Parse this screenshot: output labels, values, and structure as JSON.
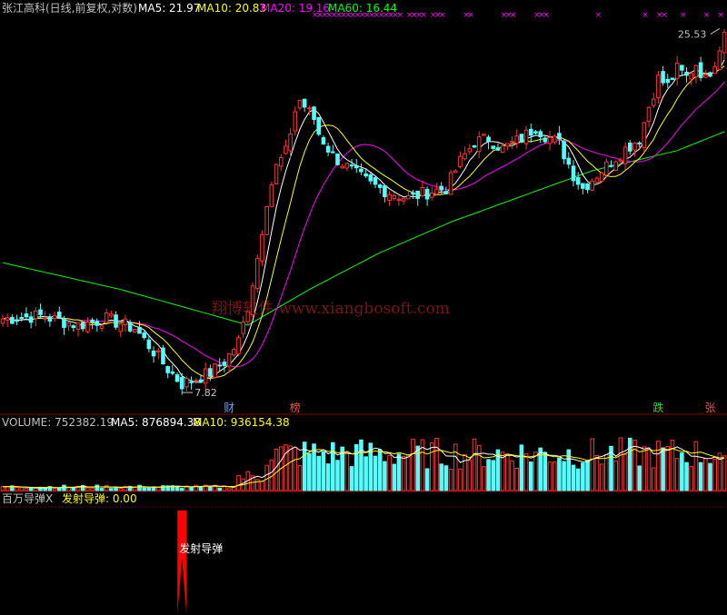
{
  "main_header": {
    "title": "张江高科(日线,前复权,对数)",
    "ma5": "MA5: 21.97",
    "ma10": "MA10: 20.83",
    "ma20": "MA20: 19.16",
    "ma60": "MA60: 16.44"
  },
  "volume_header": {
    "label": "VOLUME: 752382.19",
    "ma5": "MA5: 876894.38",
    "ma10": "MA10: 936154.38"
  },
  "indicator_header": {
    "name": "百万导弹X",
    "value": "发射导弹: 0.00"
  },
  "annotations": {
    "high": "25.53",
    "low": "7.82",
    "watermark": "翔博软件 www.xiangbosoft.com",
    "missile": "发射导弹"
  },
  "event_tags": [
    {
      "label": "财",
      "index": 48,
      "color": "#5fa8ff"
    },
    {
      "label": "榜",
      "index": 62,
      "color": "#ff4b4b"
    },
    {
      "label": "跌",
      "index": 139,
      "color": "#33d433"
    },
    {
      "label": "张",
      "index": 150,
      "color": "#ff4b4b"
    }
  ],
  "colors": {
    "up": "#ff3232",
    "down": "#54fcfc",
    "ma5": "#ffffff",
    "ma10": "#ffff00",
    "ma20": "#ff00ff",
    "ma60": "#00ff00",
    "grid": "#800000",
    "missile": "#ff0000"
  },
  "chart_data": {
    "type": "candlestick",
    "scale": "log",
    "bars": 154,
    "ylim": [
      7.5,
      26.5
    ],
    "price_keys": [
      [
        0,
        9.8
      ],
      [
        8,
        9.9
      ],
      [
        16,
        9.6
      ],
      [
        22,
        9.8
      ],
      [
        28,
        9.5
      ],
      [
        32,
        8.8
      ],
      [
        35,
        8.3
      ],
      [
        38,
        7.9
      ],
      [
        41,
        8.05
      ],
      [
        44,
        8.2
      ],
      [
        47,
        8.5
      ],
      [
        50,
        9.1
      ],
      [
        52,
        10.2
      ],
      [
        54,
        12.0
      ],
      [
        56,
        14.5
      ],
      [
        58,
        16.2
      ],
      [
        60,
        17.0
      ],
      [
        62,
        19.5
      ],
      [
        63,
        20.2
      ],
      [
        64,
        19.8
      ],
      [
        66,
        19.0
      ],
      [
        67,
        18.1
      ],
      [
        70,
        16.8
      ],
      [
        74,
        16.0
      ],
      [
        78,
        15.3
      ],
      [
        82,
        14.9
      ],
      [
        86,
        14.6
      ],
      [
        90,
        14.9
      ],
      [
        94,
        15.1
      ],
      [
        97,
        16.5
      ],
      [
        100,
        17.6
      ],
      [
        103,
        17.8
      ],
      [
        106,
        17.2
      ],
      [
        110,
        17.8
      ],
      [
        113,
        18.5
      ],
      [
        115,
        18.0
      ],
      [
        118,
        17.5
      ],
      [
        121,
        15.8
      ],
      [
        123,
        15.1
      ],
      [
        126,
        15.8
      ],
      [
        129,
        16.5
      ],
      [
        132,
        17.2
      ],
      [
        135,
        17.8
      ],
      [
        137,
        19.8
      ],
      [
        139,
        21.7
      ],
      [
        141,
        21.2
      ],
      [
        143,
        22.4
      ],
      [
        145,
        21.8
      ],
      [
        147,
        22.8
      ],
      [
        149,
        21.6
      ],
      [
        151,
        23.0
      ],
      [
        153,
        25.3
      ]
    ],
    "ma60_keys": [
      [
        0,
        11.8
      ],
      [
        25,
        10.8
      ],
      [
        45,
        9.9
      ],
      [
        52,
        9.6
      ],
      [
        65,
        10.8
      ],
      [
        80,
        12.2
      ],
      [
        95,
        13.5
      ],
      [
        110,
        14.7
      ],
      [
        125,
        16.0
      ],
      [
        135,
        16.6
      ],
      [
        143,
        17.1
      ],
      [
        153,
        18.2
      ]
    ],
    "volume": {
      "ylim": [
        0,
        1300000
      ],
      "last": 752382.19,
      "ma5": 876894.38,
      "ma10": 936154.38
    },
    "indicator": {
      "name": "发射导弹",
      "signal_index": 38,
      "value": 0.0
    }
  }
}
